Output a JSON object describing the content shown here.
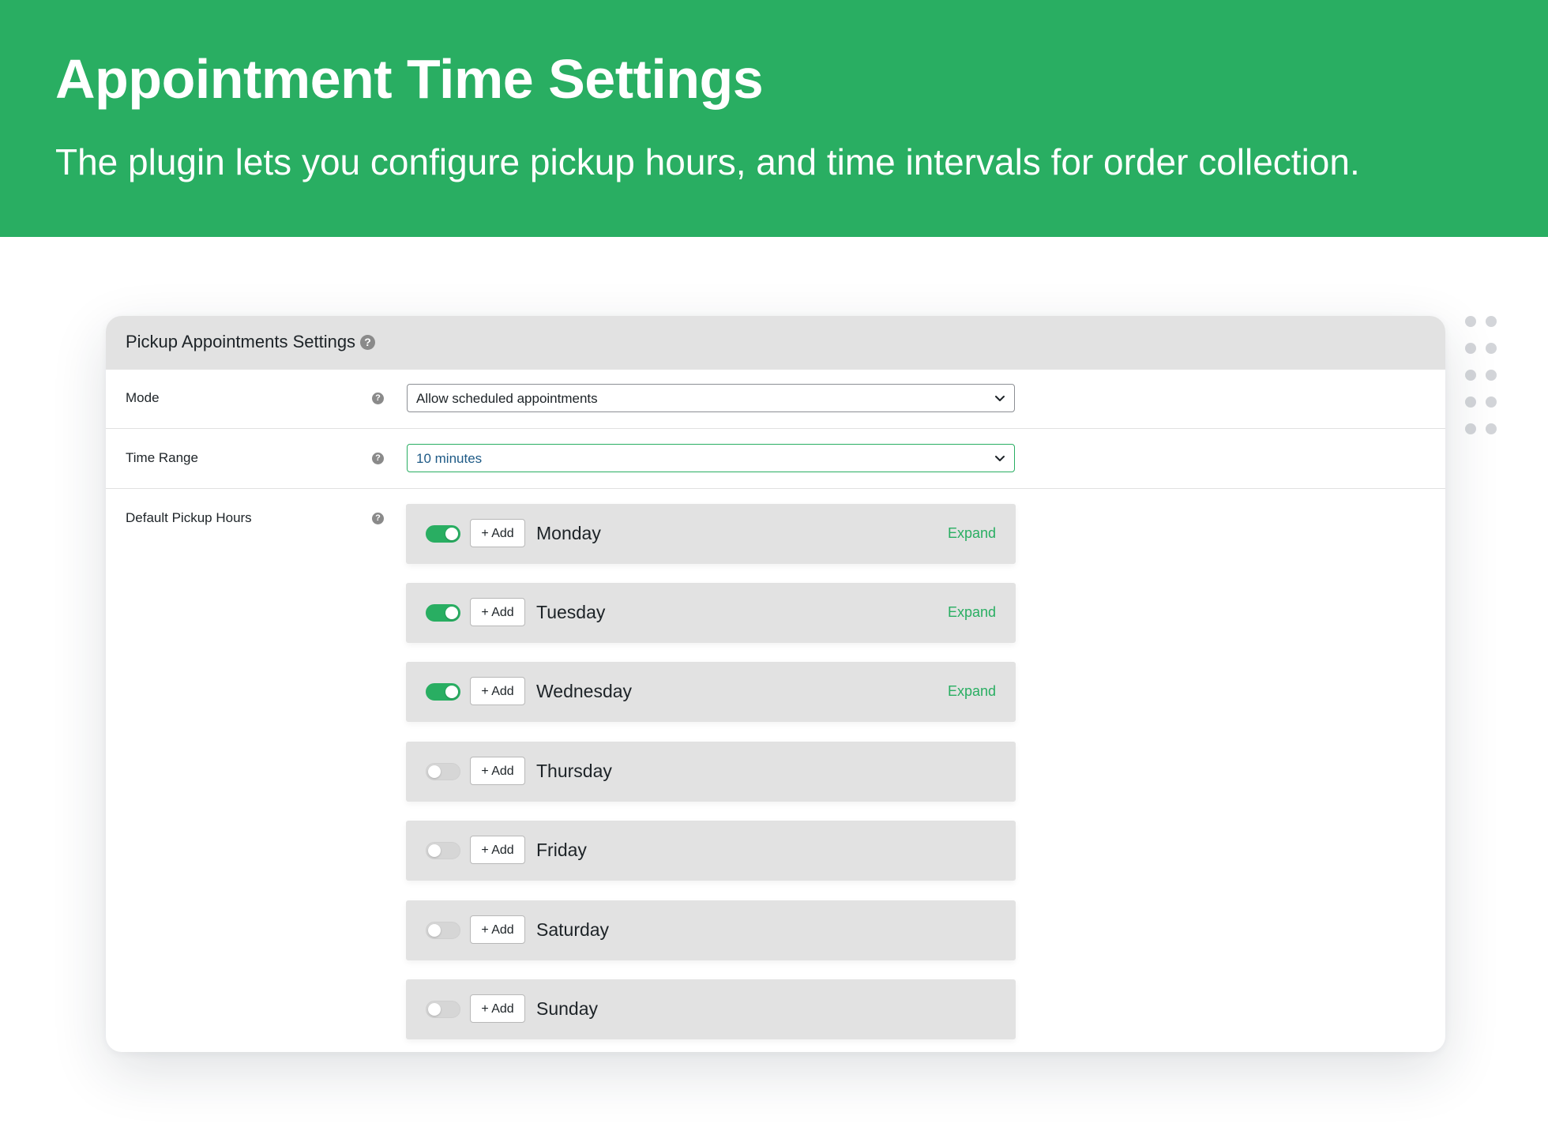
{
  "hero": {
    "title": "Appointment Time Settings",
    "subtitle": "The plugin lets you configure pickup hours, and time intervals for order collection."
  },
  "colors": {
    "accent": "#29ae62",
    "header_bg": "#e2e2e2"
  },
  "panel": {
    "title": "Pickup Appointments Settings",
    "help_icon": "question-circle-icon"
  },
  "mode": {
    "label": "Mode",
    "value": "Allow scheduled appointments"
  },
  "time_range": {
    "label": "Time Range",
    "value": "10 minutes"
  },
  "pickup_hours": {
    "label": "Default Pickup Hours",
    "add_label": "+ Add",
    "expand_label": "Expand",
    "days": [
      {
        "name": "Monday",
        "enabled": true
      },
      {
        "name": "Tuesday",
        "enabled": true
      },
      {
        "name": "Wednesday",
        "enabled": true
      },
      {
        "name": "Thursday",
        "enabled": false
      },
      {
        "name": "Friday",
        "enabled": false
      },
      {
        "name": "Saturday",
        "enabled": false
      },
      {
        "name": "Sunday",
        "enabled": false
      }
    ]
  }
}
